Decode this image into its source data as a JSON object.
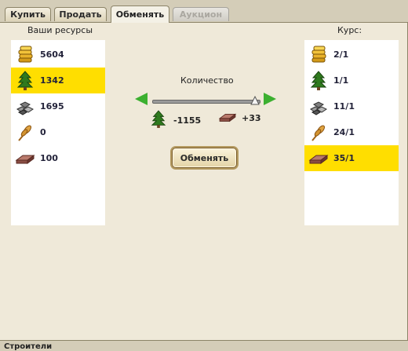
{
  "tabs": [
    {
      "label": "Купить",
      "state": "normal"
    },
    {
      "label": "Продать",
      "state": "normal"
    },
    {
      "label": "Обменять",
      "state": "active"
    },
    {
      "label": "Аукцион",
      "state": "disabled"
    }
  ],
  "left_panel": {
    "title": "Ваши ресурсы",
    "resources": [
      {
        "icon": "gold-icon",
        "value": "5604",
        "selected": false
      },
      {
        "icon": "wood-icon",
        "value": "1342",
        "selected": true
      },
      {
        "icon": "stone-icon",
        "value": "1695",
        "selected": false
      },
      {
        "icon": "wheat-icon",
        "value": "0",
        "selected": false
      },
      {
        "icon": "iron-icon",
        "value": "100",
        "selected": false
      }
    ]
  },
  "right_panel": {
    "title": "Курс:",
    "rates": [
      {
        "icon": "gold-icon",
        "value": "2/1",
        "selected": false
      },
      {
        "icon": "wood-icon",
        "value": "1/1",
        "selected": false
      },
      {
        "icon": "stone-icon",
        "value": "11/1",
        "selected": false
      },
      {
        "icon": "wheat-icon",
        "value": "24/1",
        "selected": false
      },
      {
        "icon": "iron-icon",
        "value": "35/1",
        "selected": true
      }
    ]
  },
  "exchange": {
    "quantity_label": "Количество",
    "slider_fraction": 0.95,
    "give_icon": "wood-icon",
    "give_value": "-1155",
    "get_icon": "iron-icon",
    "get_value": "+33",
    "button_label": "Обменять"
  },
  "footer": {
    "label": "Строители"
  },
  "colors": {
    "selected": "#ffde00",
    "arrow": "#3cb030",
    "panel_bg": "#efe9d9"
  }
}
